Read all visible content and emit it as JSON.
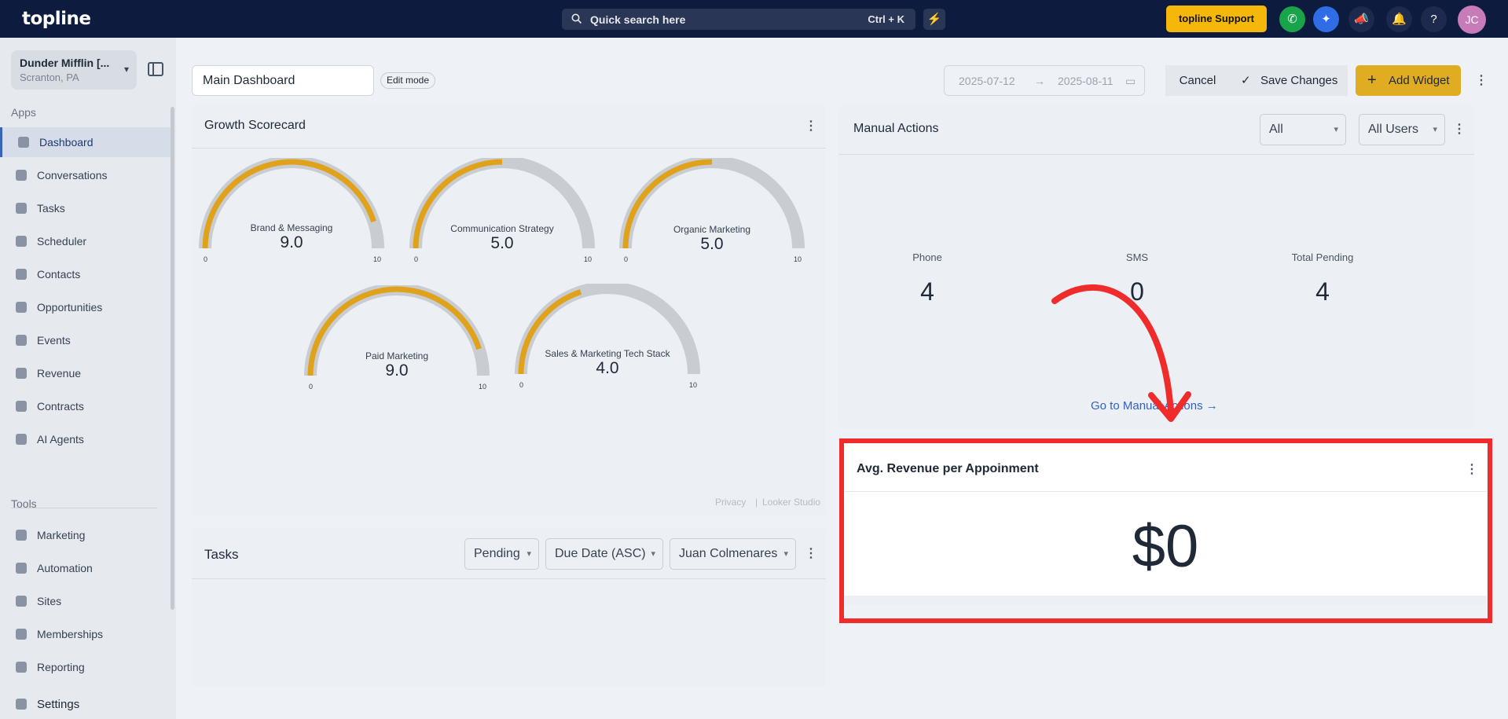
{
  "topbar": {
    "logo": "topline",
    "search_placeholder": "Quick search here",
    "search_shortcut": "Ctrl + K",
    "support_label": "topline Support",
    "avatar_initials": "JC"
  },
  "sidebar": {
    "org_name": "Dunder Mifflin [...",
    "org_location": "Scranton, PA",
    "apps_heading": "Apps",
    "apps": [
      {
        "label": "Dashboard"
      },
      {
        "label": "Conversations"
      },
      {
        "label": "Tasks"
      },
      {
        "label": "Scheduler"
      },
      {
        "label": "Contacts"
      },
      {
        "label": "Opportunities"
      },
      {
        "label": "Events"
      },
      {
        "label": "Revenue"
      },
      {
        "label": "Contracts"
      },
      {
        "label": "AI Agents"
      }
    ],
    "tools_heading": "Tools",
    "tools": [
      {
        "label": "Marketing"
      },
      {
        "label": "Automation"
      },
      {
        "label": "Sites"
      },
      {
        "label": "Memberships"
      },
      {
        "label": "Reporting"
      }
    ],
    "settings_label": "Settings"
  },
  "toolbar": {
    "dashboard_name": "Main Dashboard",
    "edit_mode_label": "Edit mode",
    "date_start": "2025-07-12",
    "date_end": "2025-08-11",
    "cancel_label": "Cancel",
    "save_label": "Save Changes",
    "add_widget_label": "Add Widget"
  },
  "growth_scorecard": {
    "title": "Growth Scorecard",
    "min_label": "0",
    "max_label": "10",
    "gauges": [
      {
        "name": "Brand & Messaging",
        "value": "9.0",
        "fraction": 0.9
      },
      {
        "name": "Communication Strategy",
        "value": "5.0",
        "fraction": 0.5
      },
      {
        "name": "Organic Marketing",
        "value": "5.0",
        "fraction": 0.5
      },
      {
        "name": "Paid Marketing",
        "value": "9.0",
        "fraction": 0.9
      },
      {
        "name": "Sales & Marketing Tech Stack",
        "value": "4.0",
        "fraction": 0.4
      }
    ],
    "privacy": "Privacy",
    "looker": "Looker Studio"
  },
  "tasks": {
    "title": "Tasks",
    "filter_status": "Pending",
    "filter_sort": "Due Date (ASC)",
    "filter_user": "Juan Colmenares"
  },
  "manual_actions": {
    "title": "Manual Actions",
    "filter_type": "All",
    "filter_users": "All Users",
    "stats": [
      {
        "label": "Phone",
        "value": "4"
      },
      {
        "label": "SMS",
        "value": "0"
      },
      {
        "label": "Total Pending",
        "value": "4"
      }
    ],
    "link_label": "Go to Manual Actions"
  },
  "avg_revenue": {
    "title": "Avg. Revenue per Appoinment",
    "value": "$0"
  },
  "colors": {
    "accent": "#e0ac22",
    "highlight": "#f02b2b",
    "nav_bg": "#0d1b3f"
  }
}
